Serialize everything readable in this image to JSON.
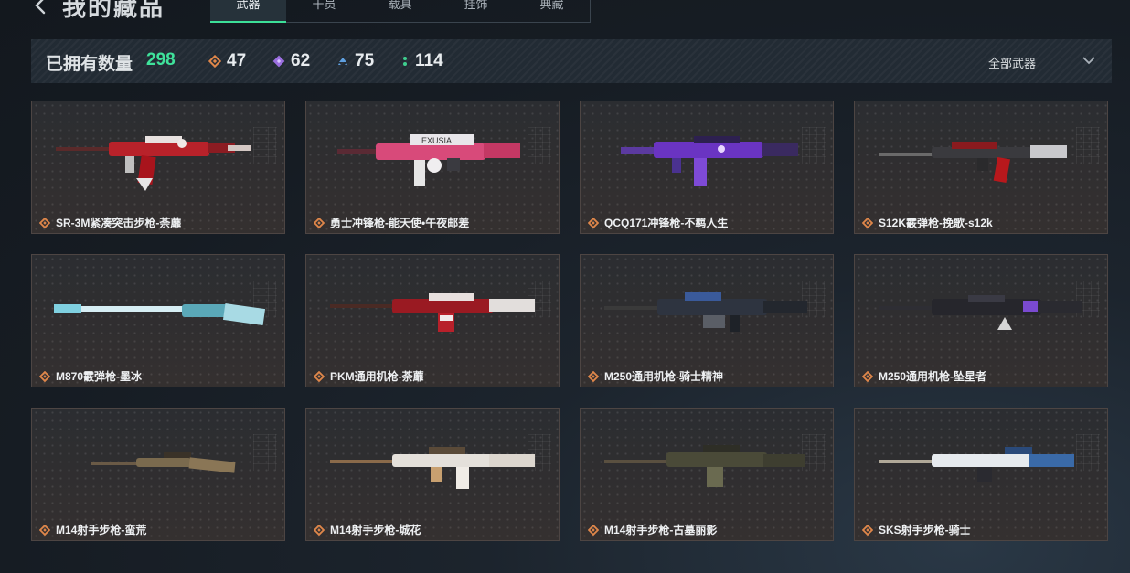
{
  "header": {
    "title": "我的藏品",
    "tabs": [
      {
        "label": "武器",
        "active": true
      },
      {
        "label": "干员",
        "active": false
      },
      {
        "label": "载具",
        "active": false
      },
      {
        "label": "挂饰",
        "active": false
      },
      {
        "label": "典藏",
        "active": false
      }
    ]
  },
  "stats": {
    "owned_label": "已拥有数量",
    "owned_count": "298",
    "rarities": [
      {
        "icon": "orange-diamond-icon",
        "color": "#e0874a",
        "count": "47"
      },
      {
        "icon": "purple-diamond-icon",
        "color": "#9b6fe0",
        "count": "62"
      },
      {
        "icon": "blue-diamond-icon",
        "color": "#5fa0e0",
        "count": "75"
      },
      {
        "icon": "green-dots-icon",
        "color": "#3fcf8f",
        "count": "114"
      }
    ],
    "filter_label": "全部武器"
  },
  "items": [
    {
      "name": "SR-3M紧凑突击步枪-荼蘼",
      "skin": "red-white"
    },
    {
      "name": "勇士冲锋枪-能天使•午夜邮差",
      "skin": "pink-white"
    },
    {
      "name": "QCQ171冲锋枪-不羁人生",
      "skin": "purple"
    },
    {
      "name": "S12K霰弹枪-挽歌-s12k",
      "skin": "red-dark"
    },
    {
      "name": "M870霰弹枪-墨冰",
      "skin": "ice"
    },
    {
      "name": "PKM通用机枪-荼蘼",
      "skin": "red-white"
    },
    {
      "name": "M250通用机枪-骑士精神",
      "skin": "blue-dark"
    },
    {
      "name": "M250通用机枪-坠星者",
      "skin": "purple-dark"
    },
    {
      "name": "M14射手步枪-蛮荒",
      "skin": "camo"
    },
    {
      "name": "M14射手步枪-城花",
      "skin": "white-gold"
    },
    {
      "name": "M14射手步枪-古墓丽影",
      "skin": "olive"
    },
    {
      "name": "SKS射手步枪-骑士",
      "skin": "white-blue"
    }
  ],
  "colors": {
    "accent_green": "#3fe29b",
    "rarity_orange": "#e0874a",
    "card_border": "#4d4543"
  }
}
